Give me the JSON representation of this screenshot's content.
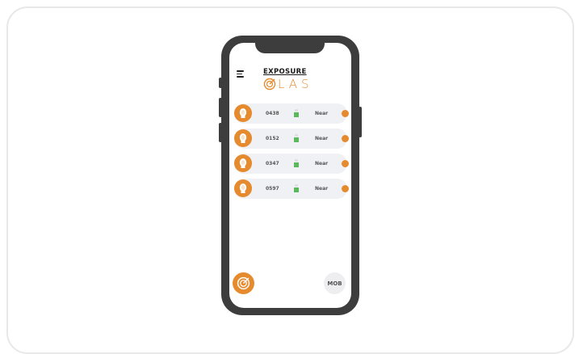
{
  "app": {
    "logo_top": "EXPOSURE",
    "logo_bottom": "LAS"
  },
  "people": [
    {
      "id": "0438",
      "distance": "Near"
    },
    {
      "id": "0152",
      "distance": "Near"
    },
    {
      "id": "0347",
      "distance": "Near"
    },
    {
      "id": "0597",
      "distance": "Near"
    }
  ],
  "footer": {
    "mob_label": "MOB"
  },
  "colors": {
    "accent": "#e68a2e",
    "signal": "#5cb85c",
    "phone_body": "#3d3d3d",
    "row_bg": "#f0f1f4"
  },
  "icons": {
    "menu": "hamburger-menu-icon",
    "logo": "radar-target-icon",
    "avatar": "person-head-icon",
    "signal": "signal-strength-icon",
    "action": "locate-icon",
    "radar": "radar-icon"
  }
}
